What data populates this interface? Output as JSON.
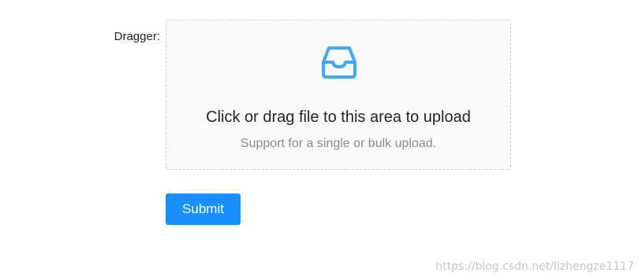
{
  "form": {
    "dragger_label": "Dragger:",
    "dragger": {
      "icon": "inbox-icon",
      "text": "Click or drag file to this area to upload",
      "hint": "Support for a single or bulk upload."
    },
    "submit_label": "Submit"
  },
  "watermark": "https://blog.csdn.net/lizhengze1117",
  "colors": {
    "primary": "#1890ff",
    "dragger_bg": "#fafafa",
    "dragger_border": "#d0d0d0",
    "text": "#262626",
    "hint": "#8c8c8c"
  }
}
